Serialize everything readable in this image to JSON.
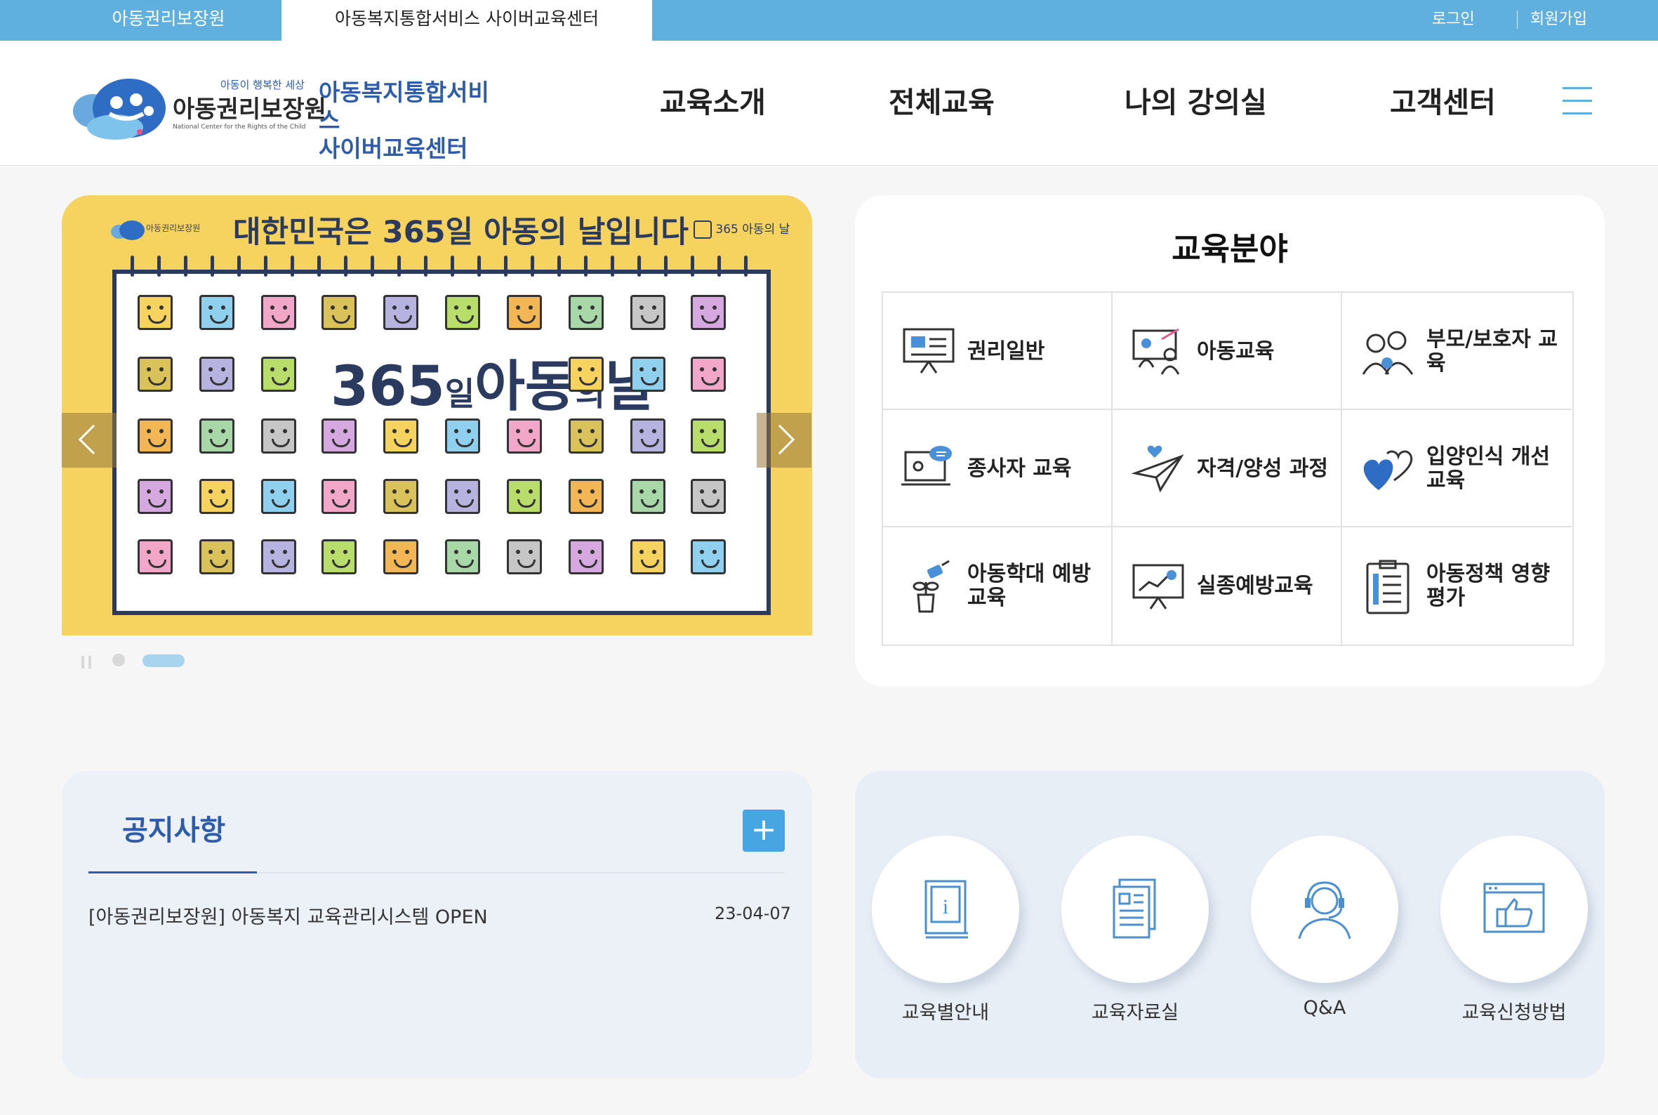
{
  "topbar": {
    "site_link": "아동권리보장원",
    "active_site": "아동복지통합서비스 사이버교육센터",
    "login": "로그인",
    "signup": "회원가입"
  },
  "header": {
    "logo_tagline": "아동이 행복한 세상",
    "logo_org": "아동권리보장원",
    "logo_org_en": "National Center for the Rights of the Child",
    "logo_service_line1": "아동복지통합서비스",
    "logo_service_line2": "사이버교육센터",
    "nav": [
      "교육소개",
      "전체교육",
      "나의 강의실",
      "고객센터"
    ]
  },
  "banner": {
    "logo_text": "아동권리보장원",
    "title": "대한민국은 365일 아동의 날입니다",
    "badge": "365 아동의 날",
    "calendar_text": "365",
    "calendar_small1": "일",
    "calendar_big2": "아동",
    "calendar_small2": "의",
    "calendar_big3": "날",
    "slides_total": 2,
    "active_slide": 2
  },
  "fields": {
    "title": "교육분야",
    "items": [
      {
        "label": "권리일반",
        "icon": "presentation-board-icon"
      },
      {
        "label": "아동교육",
        "icon": "classroom-teacher-icon"
      },
      {
        "label": "부모/보호자 교육",
        "icon": "parents-child-icon"
      },
      {
        "label": "종사자 교육",
        "icon": "online-lecture-icon"
      },
      {
        "label": "자격/양성 과정",
        "icon": "paper-plane-icon"
      },
      {
        "label": "입양인식 개선 교육",
        "icon": "hearts-icon"
      },
      {
        "label": "아동학대 예방교육",
        "icon": "watering-plant-icon"
      },
      {
        "label": "실종예방교육",
        "icon": "chart-board-icon"
      },
      {
        "label": "아동정책 영향평가",
        "icon": "checklist-icon"
      }
    ]
  },
  "notice": {
    "title": "공지사항",
    "more": "+",
    "items": [
      {
        "title": "[아동권리보장원] 아동복지 교육관리시스템 OPEN",
        "date": "23-04-07"
      }
    ]
  },
  "quick_links": [
    {
      "label": "교육별안내",
      "icon": "info-book-icon"
    },
    {
      "label": "교육자료실",
      "icon": "documents-icon"
    },
    {
      "label": "Q&A",
      "icon": "headset-agent-icon"
    },
    {
      "label": "교육신청방법",
      "icon": "thumbs-up-icon"
    }
  ],
  "colors": {
    "accent": "#5fb0de",
    "brand_navy": "#2c5caa",
    "banner_yellow": "#f6d25e",
    "plus_blue": "#47a5e1"
  }
}
